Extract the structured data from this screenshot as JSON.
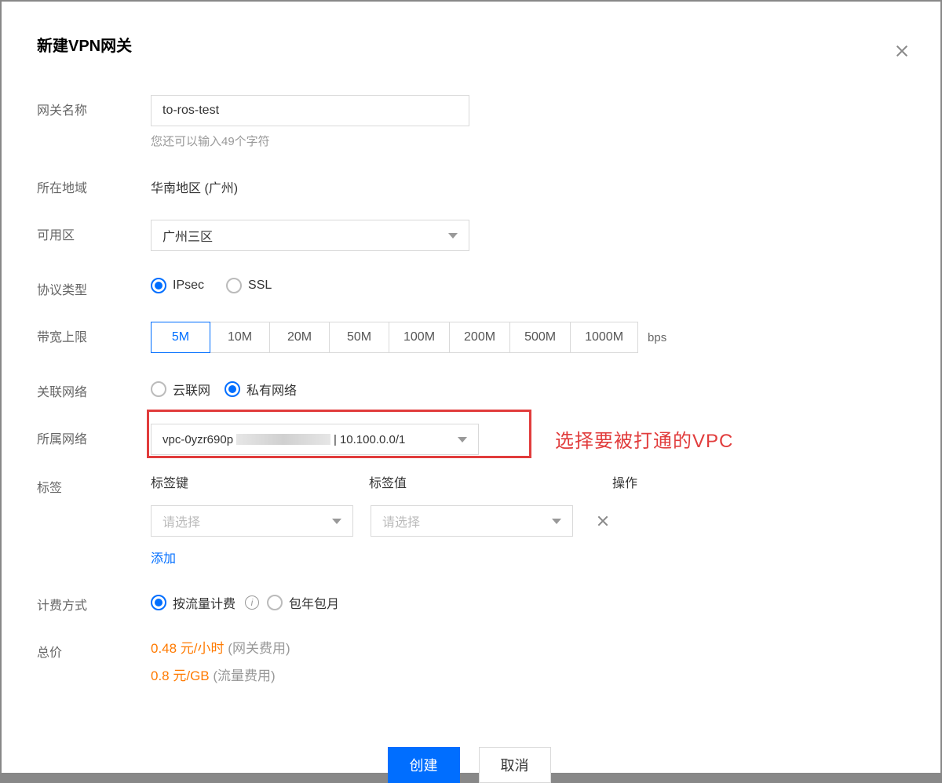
{
  "dialog": {
    "title": "新建VPN网关"
  },
  "name": {
    "label": "网关名称",
    "value": "to-ros-test",
    "hint": "您还可以输入49个字符"
  },
  "region": {
    "label": "所在地域",
    "value": "华南地区 (广州)"
  },
  "zone": {
    "label": "可用区",
    "value": "广州三区"
  },
  "protocol": {
    "label": "协议类型",
    "ipsec": "IPsec",
    "ssl": "SSL"
  },
  "bandwidth": {
    "label": "带宽上限",
    "options": [
      "5M",
      "10M",
      "20M",
      "50M",
      "100M",
      "200M",
      "500M",
      "1000M"
    ],
    "unit": "bps",
    "selected": "5M"
  },
  "assoc_net": {
    "label": "关联网络",
    "ccn": "云联网",
    "vpc": "私有网络"
  },
  "own_net": {
    "label": "所属网络",
    "prefix": "vpc-0yzr690p",
    "cidr": "10.100.0.0/1",
    "sep": " | ",
    "annotation": "选择要被打通的VPC"
  },
  "tags": {
    "label": "标签",
    "col_key": "标签键",
    "col_val": "标签值",
    "col_op": "操作",
    "placeholder": "请选择",
    "add": "添加"
  },
  "billing": {
    "label": "计费方式",
    "usage": "按流量计费",
    "monthly": "包年包月"
  },
  "total": {
    "label": "总价",
    "gateway_price": "0.48 元/小时",
    "gateway_note": "(网关费用)",
    "traffic_price": "0.8 元/GB",
    "traffic_note": "(流量费用)"
  },
  "footer": {
    "create": "创建",
    "cancel": "取消"
  }
}
